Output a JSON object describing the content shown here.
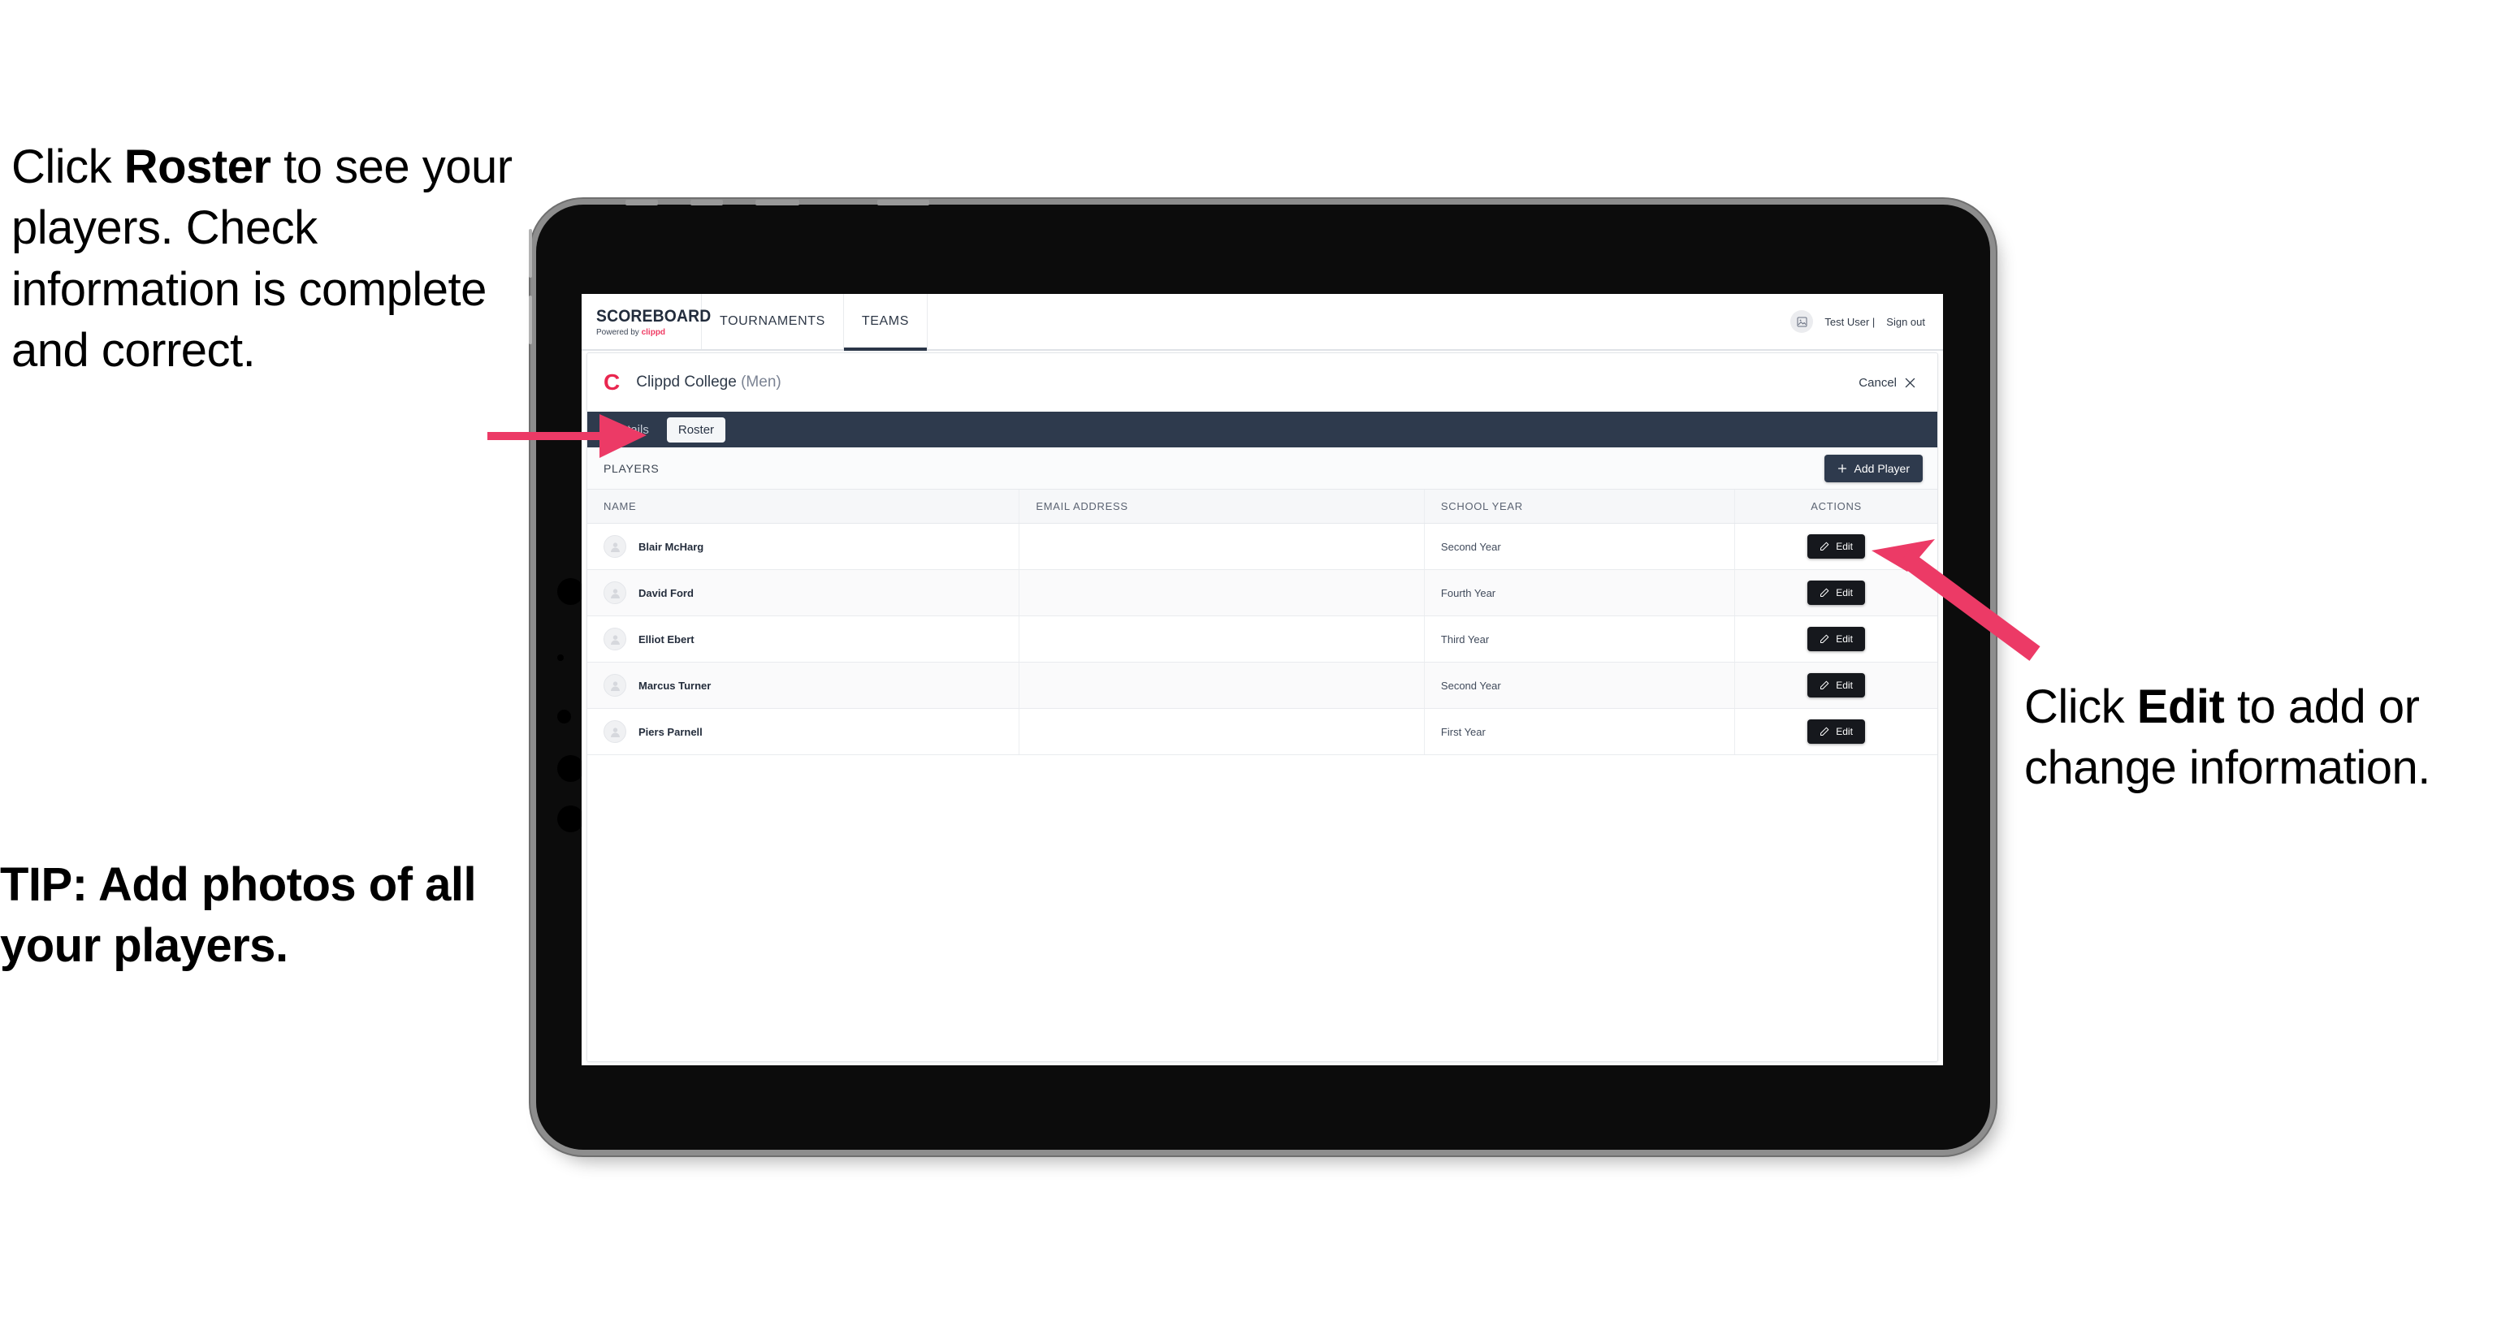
{
  "callouts": {
    "left": {
      "part1": "Click ",
      "bold": "Roster",
      "part2": " to see your players. Check information is complete and correct."
    },
    "tip": "TIP: Add photos of all your players.",
    "right": {
      "part1": "Click ",
      "bold": "Edit",
      "part2": " to add or change information."
    }
  },
  "app": {
    "brand": {
      "wordmark": "SCOREBOARD",
      "powered_prefix": "Powered by ",
      "powered_brand": "clippd"
    },
    "nav_tabs": [
      {
        "label": "TOURNAMENTS",
        "active": false
      },
      {
        "label": "TEAMS",
        "active": true
      }
    ],
    "user": {
      "name": "Test User |",
      "signout": "Sign out",
      "avatar_icon": "image-placeholder-icon"
    },
    "team_header": {
      "logo_letter": "C",
      "name": "Clippd College",
      "gender": "(Men)",
      "cancel_label": "Cancel",
      "cancel_icon": "close-icon"
    },
    "sub_tabs": [
      {
        "label": "Details",
        "selected": false
      },
      {
        "label": "Roster",
        "selected": true
      }
    ],
    "players_section": {
      "label": "PLAYERS",
      "add_button_label": "Add Player",
      "add_button_icon": "plus-icon"
    },
    "table": {
      "columns": [
        "NAME",
        "EMAIL ADDRESS",
        "SCHOOL YEAR",
        "ACTIONS"
      ],
      "edit_label": "Edit",
      "edit_icon": "pencil-icon",
      "rows": [
        {
          "name": "Blair McHarg",
          "email": "",
          "school_year": "Second Year"
        },
        {
          "name": "David Ford",
          "email": "",
          "school_year": "Fourth Year"
        },
        {
          "name": "Elliot Ebert",
          "email": "",
          "school_year": "Third Year"
        },
        {
          "name": "Marcus Turner",
          "email": "",
          "school_year": "Second Year"
        },
        {
          "name": "Piers Parnell",
          "email": "",
          "school_year": "First Year"
        }
      ]
    }
  },
  "colors": {
    "accent_pink": "#ec3a66",
    "brand_red": "#e9264f",
    "dark_navy": "#2e3a4d",
    "edit_black": "#16181d",
    "page_bg": "#ffffff"
  }
}
